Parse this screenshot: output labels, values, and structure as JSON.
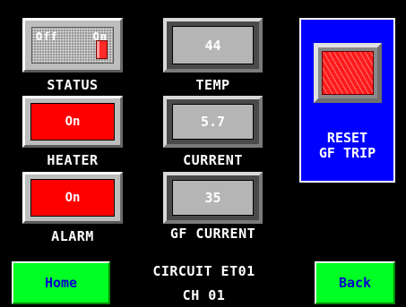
{
  "status": {
    "label": "STATUS",
    "off_text": "Off",
    "on_text": "On",
    "state": "on"
  },
  "temp": {
    "label": "TEMP",
    "value": "44"
  },
  "heater": {
    "label": "HEATER",
    "button_text": "On"
  },
  "current": {
    "label": "CURRENT",
    "value": "5.7"
  },
  "alarm": {
    "label": "ALARM",
    "button_text": "On"
  },
  "gf_current": {
    "label": "GF CURRENT",
    "value": "35"
  },
  "reset": {
    "line1": "RESET",
    "line2": "GF TRIP"
  },
  "footer": {
    "home_label": "Home",
    "back_label": "Back",
    "circuit": "CIRCUIT ET01",
    "channel": "CH 01"
  },
  "colors": {
    "background": "#000000",
    "indicator_red": "#ff0000",
    "panel_blue": "#0000ff",
    "nav_green": "#00ff22",
    "nav_text": "#0000cc"
  }
}
